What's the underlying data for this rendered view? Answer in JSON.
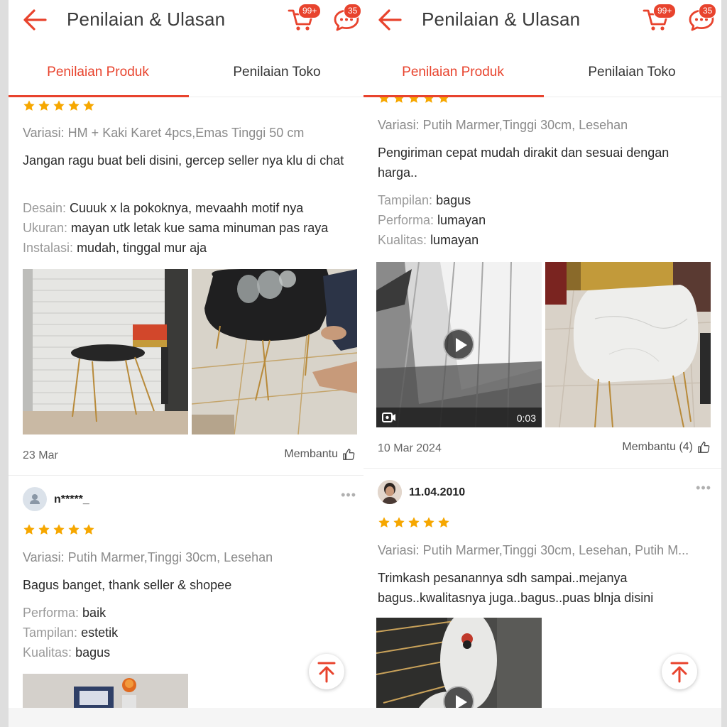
{
  "colors": {
    "accent": "#e8432d",
    "star": "#f6a700"
  },
  "left": {
    "header": {
      "title": "Penilaian & Ulasan",
      "cart_badge": "99+",
      "chat_badge": "35"
    },
    "tabs": [
      "Penilaian Produk",
      "Penilaian Toko"
    ],
    "review1": {
      "variant": "Variasi: HM + Kaki Karet 4pcs,Emas Tinggi 50 cm",
      "body": "Jangan ragu buat beli disini, gercep seller nya klu di chat",
      "attrs": [
        {
          "k": "Desain:",
          "v": "Cuuuk x la pokoknya, mevaahh motif nya"
        },
        {
          "k": "Ukuran:",
          "v": "mayan utk letak kue sama minuman pas raya"
        },
        {
          "k": "Instalasi:",
          "v": "mudah, tinggal mur aja"
        }
      ],
      "date": "23 Mar",
      "helpful": "Membantu"
    },
    "review2": {
      "username": "n*****_",
      "variant": "Variasi: Putih Marmer,Tinggi 30cm, Lesehan",
      "body": "Bagus banget, thank seller & shopee",
      "attrs": [
        {
          "k": "Performa:",
          "v": "baik"
        },
        {
          "k": "Tampilan:",
          "v": "estetik"
        },
        {
          "k": "Kualitas:",
          "v": "bagus"
        }
      ]
    }
  },
  "right": {
    "header": {
      "title": "Penilaian & Ulasan",
      "cart_badge": "99+",
      "chat_badge": "35"
    },
    "tabs": [
      "Penilaian Produk",
      "Penilaian Toko"
    ],
    "review1": {
      "variant": "Variasi: Putih Marmer,Tinggi 30cm, Lesehan",
      "body": "Pengiriman cepat mudah dirakit dan sesuai dengan harga..",
      "attrs": [
        {
          "k": "Tampilan:",
          "v": "bagus"
        },
        {
          "k": "Performa:",
          "v": "lumayan"
        },
        {
          "k": "Kualitas:",
          "v": "lumayan"
        }
      ],
      "video_duration": "0:03",
      "date": "10 Mar 2024",
      "helpful": "Membantu (4)"
    },
    "review2": {
      "username": "11.04.2010",
      "variant": "Variasi: Putih Marmer,Tinggi 30cm, Lesehan, Putih M...",
      "body": "Trimkash pesanannya sdh sampai..mejanya bagus..kwalitasnya juga..bagus..puas blnja disini"
    }
  }
}
